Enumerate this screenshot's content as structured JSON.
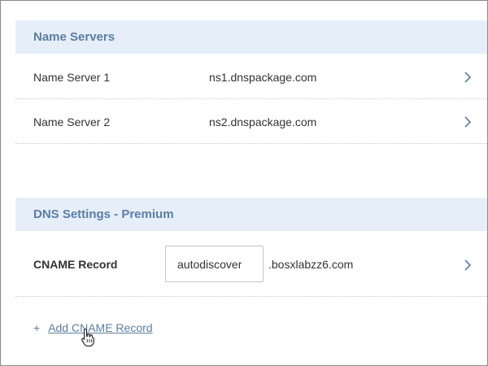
{
  "name_servers": {
    "title": "Name Servers",
    "items": [
      {
        "label": "Name Server 1",
        "value": "ns1.dnspackage.com"
      },
      {
        "label": "Name Server 2",
        "value": "ns2.dnspackage.com"
      }
    ]
  },
  "dns_settings": {
    "title": "DNS Settings - Premium",
    "cname": {
      "label": "CNAME Record",
      "host_value": "autodiscover",
      "domain_suffix": ".bosxlabzz6.com"
    },
    "add_action": {
      "plus": "+",
      "label": "Add CNAME Record"
    }
  },
  "icons": {
    "row_arrow": "chevron-right-icon",
    "pointer": "hand-pointer-icon"
  },
  "colors": {
    "header_bg": "#e5eef9",
    "header_text": "#5a7ea8",
    "link": "#5a7ea8",
    "body_text": "#333333"
  }
}
